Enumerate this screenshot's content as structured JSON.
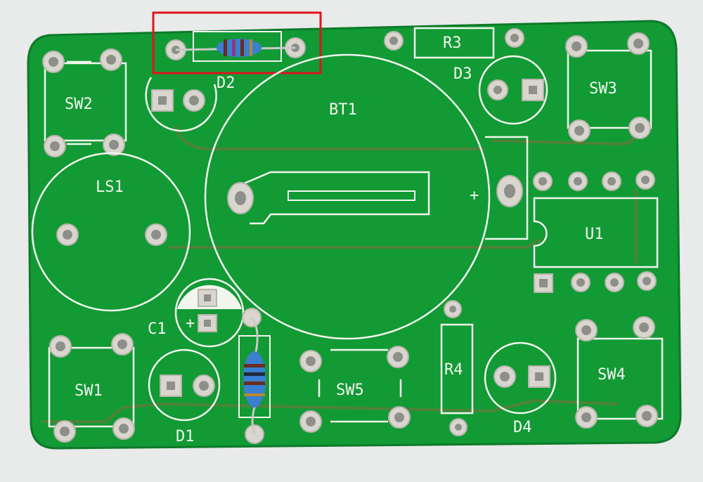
{
  "board": {
    "colors": {
      "background": "#e9eaea",
      "pcb": "#129a35",
      "pcb_edge": "#0d7a29",
      "silkscreen": "#f3f6ee",
      "trace": "#6b6a35",
      "pad": "#d9d6cf",
      "pad_hole": "#8f8f8a",
      "highlight": "#e0141c",
      "resistor_body": "#3a7fd0"
    },
    "labels": {
      "sw2": "SW2",
      "d2": "D2",
      "bt1": "BT1",
      "r3": "R3",
      "d3": "D3",
      "sw3": "SW3",
      "ls1": "LS1",
      "plus_bt": "+",
      "u1": "U1",
      "c1": "C1",
      "plus_c1": "+",
      "sw1": "SW1",
      "d1": "D1",
      "sw5": "SW5",
      "r4": "R4",
      "d4": "D4",
      "sw4": "SW4"
    }
  },
  "annotation": {
    "highlight_target": "resistor-d2"
  }
}
